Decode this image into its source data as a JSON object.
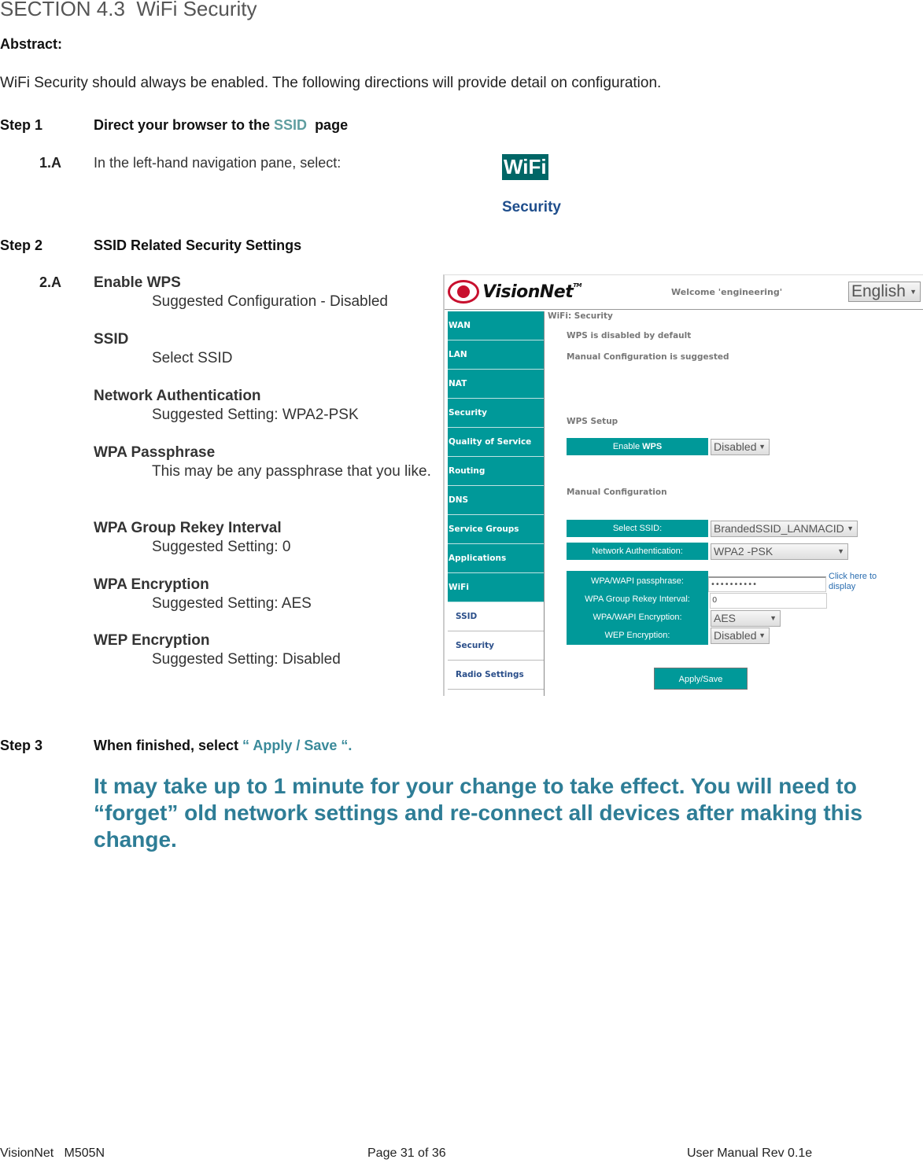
{
  "section_title": "SECTION 4.3  WiFi Security",
  "abstract": {
    "label": "Abstract:",
    "text": "WiFi Security should always be enabled. The following directions will provide detail on configuration."
  },
  "step1": {
    "label": "Step 1",
    "text_before": "Direct your browser to the ",
    "link": "SSID",
    "text_after": "  page",
    "sub_label": "1.A",
    "sub_text": "In the left-hand navigation pane, select:",
    "nav_primary": "WiFi",
    "nav_secondary": "Security"
  },
  "step2": {
    "label": "Step 2",
    "text": "SSID Related Security Settings",
    "sub_label": "2.A",
    "settings": [
      {
        "name": "Enable WPS",
        "value": "Suggested Configuration - Disabled"
      },
      {
        "name": "SSID",
        "value": "Select SSID"
      },
      {
        "name": "Network Authentication",
        "value": "Suggested Setting: WPA2-PSK"
      },
      {
        "name": "WPA Passphrase",
        "value": "This may be any passphrase that you like."
      },
      {
        "name": "WPA Group Rekey Interval",
        "value": "Suggested Setting: 0"
      },
      {
        "name": "WPA Encryption",
        "value": "Suggested Setting: AES"
      },
      {
        "name": "WEP Encryption",
        "value": "Suggested Setting: Disabled"
      }
    ]
  },
  "screenshot": {
    "brand": "VisionNet",
    "tm": "TM",
    "welcome": "Welcome 'engineering'",
    "language": "English",
    "sidebar": [
      "WAN",
      "LAN",
      "NAT",
      "Security",
      "Quality of Service",
      "Routing",
      "DNS",
      "Service Groups",
      "Applications",
      "WiFi"
    ],
    "sidebar_sub": [
      "SSID",
      "Security",
      "Radio Settings"
    ],
    "page_heading": "WiFi: Security",
    "info1": "WPS is disabled by default",
    "info2": "Manual Configuration is suggested",
    "wps_setup": "WPS Setup",
    "enable_wps_label": "Enable ",
    "enable_wps_bold": "WPS",
    "enable_wps_value": "Disabled",
    "manual_config": "Manual Configuration",
    "select_ssid_label": "Select SSID:",
    "select_ssid_value": "BrandedSSID_LANMACID",
    "net_auth_label": "Network Authentication:",
    "net_auth_value": "WPA2 -PSK",
    "passphrase_label": "WPA/WAPI passphrase:",
    "passphrase_value": "••••••••••",
    "show_link": "Click here to display",
    "rekey_label": "WPA Group Rekey Interval:",
    "rekey_value": "0",
    "wpa_enc_label": "WPA/WAPI Encryption:",
    "wpa_enc_value": "AES",
    "wep_enc_label": "WEP Encryption:",
    "wep_enc_value": "Disabled",
    "apply_save": "Apply/Save"
  },
  "step3": {
    "label": "Step 3",
    "text_before": "When finished, select ",
    "quote": "“ Apply / Save “.",
    "note": "It may take up to 1 minute for your change to take effect. You will need to “forget” old network settings and re-connect all devices after making this change."
  },
  "footer": {
    "left": "VisionNet   M505N",
    "center": "Page 31 of 36",
    "right": "User Manual Rev 0.1e"
  }
}
